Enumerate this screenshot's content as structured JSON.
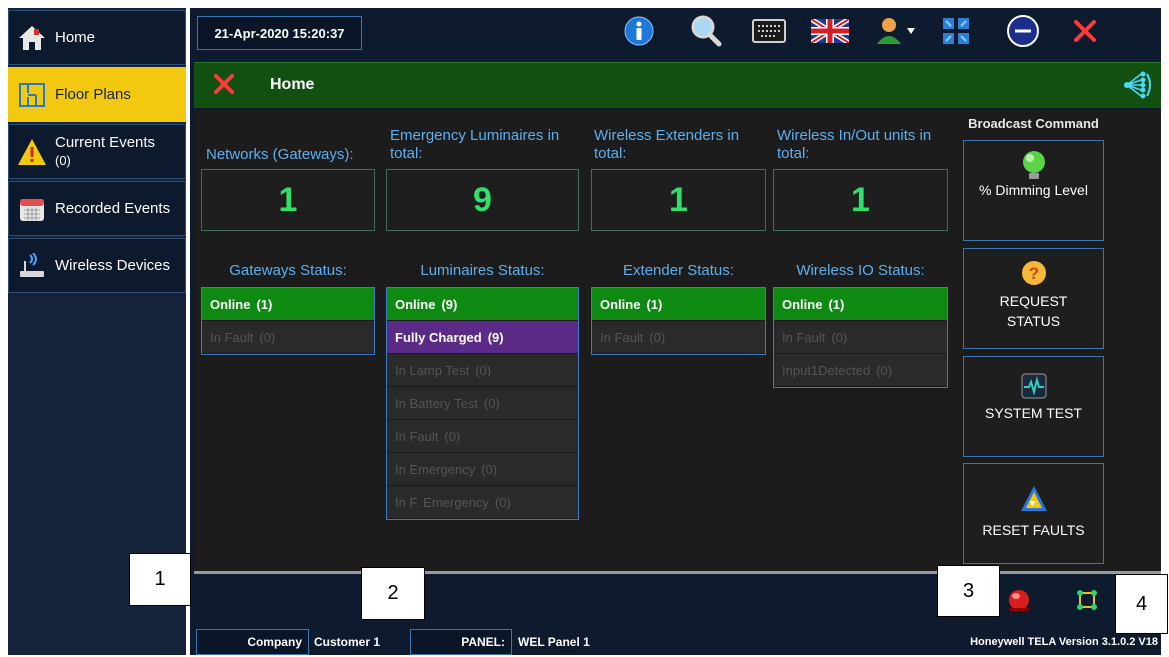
{
  "sidebar": {
    "items": [
      {
        "label": "Home",
        "icon": "home-icon"
      },
      {
        "label": "Floor Plans",
        "icon": "floor-plan-icon"
      },
      {
        "label": "Current Events",
        "sub": "(0)",
        "icon": "warning-icon"
      },
      {
        "label": "Recorded Events",
        "icon": "calendar-icon"
      },
      {
        "label": "Wireless Devices",
        "icon": "wireless-router-icon"
      }
    ]
  },
  "header": {
    "datetime": "21-Apr-2020 15:20:37",
    "icons": [
      "info-icon",
      "search-icon",
      "keyboard-icon",
      "uk-flag-icon",
      "user-menu-icon",
      "fullscreen-icon",
      "minimize-icon",
      "close-icon"
    ]
  },
  "page": {
    "title": "Home",
    "close_icon": "close-icon",
    "network_icon": "network-icon"
  },
  "summary": [
    {
      "label": "Networks (Gateways):",
      "value": "1"
    },
    {
      "label": "Emergency Luminaires in total:",
      "value": "9"
    },
    {
      "label": "Wireless Extenders in total:",
      "value": "1"
    },
    {
      "label": "Wireless In/Out units in total:",
      "value": "1"
    }
  ],
  "status": [
    {
      "title": "Gateways Status:",
      "rows": [
        {
          "label": "Online",
          "count": "(1)",
          "state": "online"
        },
        {
          "label": "In Fault",
          "count": "(0)",
          "state": "off"
        }
      ]
    },
    {
      "title": "Luminaires Status:",
      "rows": [
        {
          "label": "Online",
          "count": "(9)",
          "state": "online"
        },
        {
          "label": "Fully Charged",
          "count": "(9)",
          "state": "charged"
        },
        {
          "label": "In Lamp Test",
          "count": "(0)",
          "state": "off"
        },
        {
          "label": "In Battery Test",
          "count": "(0)",
          "state": "off"
        },
        {
          "label": "In Fault",
          "count": "(0)",
          "state": "off"
        },
        {
          "label": "In Emergency",
          "count": "(0)",
          "state": "off"
        },
        {
          "label": "In F. Emergency",
          "count": "(0)",
          "state": "off"
        }
      ]
    },
    {
      "title": "Extender Status:",
      "rows": [
        {
          "label": "Online",
          "count": "(1)",
          "state": "online"
        },
        {
          "label": "In Fault",
          "count": "(0)",
          "state": "off"
        }
      ]
    },
    {
      "title": "Wireless IO Status:",
      "rows": [
        {
          "label": "Online",
          "count": "(1)",
          "state": "online"
        },
        {
          "label": "In Fault",
          "count": "(0)",
          "state": "off"
        },
        {
          "label": "Input1Detected",
          "count": "(0)",
          "state": "off"
        }
      ]
    }
  ],
  "broadcast": {
    "title": "Broadcast Command",
    "buttons": [
      {
        "label": "% Dimming Level",
        "icon": "dimming-bulb-icon"
      },
      {
        "label": "REQUEST STATUS",
        "icon": "question-icon"
      },
      {
        "label": "SYSTEM TEST",
        "icon": "heartbeat-icon"
      },
      {
        "label": "RESET FAULTS",
        "icon": "reset-faults-icon"
      }
    ]
  },
  "footer": {
    "company_label": "Company",
    "company_value": "Customer 1",
    "panel_label": "PANEL:",
    "panel_value": "WEL Panel 1",
    "version": "Honeywell TELA Version 3.1.0.2 V18",
    "alarm_icon": "alarm-bell-icon",
    "settings_icon": "connect-icon"
  },
  "callouts": [
    "1",
    "2",
    "3",
    "4"
  ]
}
